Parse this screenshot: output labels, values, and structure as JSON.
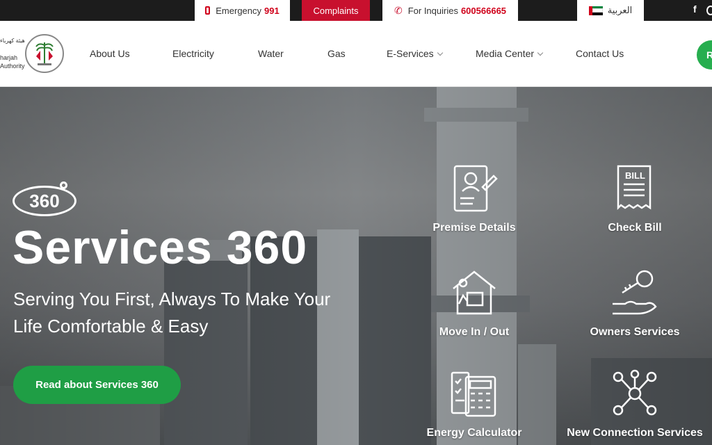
{
  "topbar": {
    "emergency_label": "Emergency",
    "emergency_number": "991",
    "complaints_label": "Complaints",
    "inquiries_label": "For Inquiries",
    "inquiries_number": "600566665",
    "language_label": "العربية",
    "social": [
      "f"
    ]
  },
  "logo": {
    "arabic_text": "هيئة كهرباء",
    "line1": "harjah",
    "line2": "Authority"
  },
  "nav": {
    "items": [
      {
        "label": "About Us"
      },
      {
        "label": "Electricity"
      },
      {
        "label": "Water"
      },
      {
        "label": "Gas"
      },
      {
        "label": "E-Services"
      },
      {
        "label": "Media Center"
      },
      {
        "label": "Contact Us"
      }
    ],
    "cta_label": "R"
  },
  "hero": {
    "badge": "360",
    "title": "Services 360",
    "subtitle": "Serving You First, Always To Make Your Life Comfortable & Easy",
    "button_label": "Read about Services 360"
  },
  "services": [
    {
      "label": "Premise Details",
      "icon": "premise-details-icon"
    },
    {
      "label": "Check Bill",
      "icon": "bill-icon"
    },
    {
      "label": "Move In / Out",
      "icon": "move-in-out-icon"
    },
    {
      "label": "Owners Services",
      "icon": "owner-key-icon"
    },
    {
      "label": "Energy Calculator",
      "icon": "calculator-icon"
    },
    {
      "label": "New Connection Services",
      "icon": "network-icon"
    }
  ],
  "colors": {
    "accent_red": "#c8102e",
    "accent_green": "#1f9e45",
    "topbar_bg": "#1c1c1c"
  }
}
